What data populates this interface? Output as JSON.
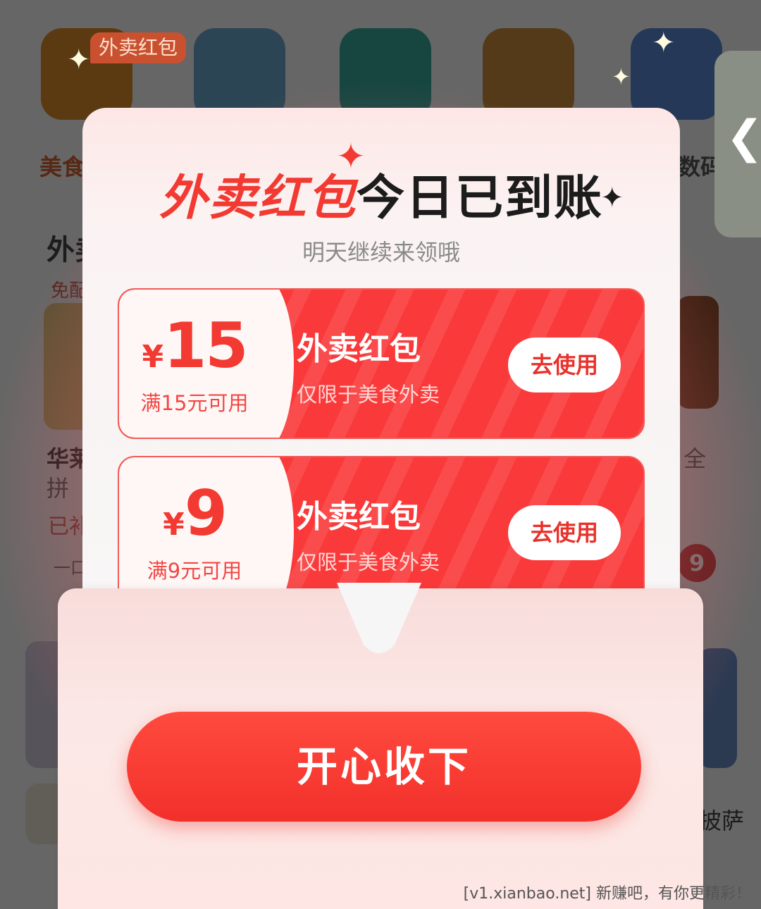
{
  "background": {
    "category_tag": "外卖红包",
    "categories": [
      "美食",
      "数码"
    ],
    "section_title": "外卖",
    "free_tag": "免配",
    "item_name_1": "华莱",
    "item_name_2": "拼",
    "sold_text": "已补",
    "item_name_right": "全",
    "one_tag": "一口",
    "badge_num": "9",
    "pizza_text": "披萨",
    "side_tab_glyph": "❮"
  },
  "modal": {
    "title_red": "外卖红包",
    "title_dark": "今日已到账",
    "subtitle": "明天继续来领哦",
    "coupons": [
      {
        "currency": "¥",
        "amount": "15",
        "condition": "满15元可用",
        "title": "外卖红包",
        "desc": "仅限于美食外卖",
        "button": "去使用"
      },
      {
        "currency": "¥",
        "amount": "9",
        "condition": "满9元可用",
        "title": "外卖红包",
        "desc": "仅限于美食外卖",
        "button": "去使用"
      }
    ],
    "cta": "开心收下"
  },
  "watermark": "[v1.xianbao.net] 新赚吧，有你更精彩！",
  "colors": {
    "accent_red": "#f23a32",
    "button_red": "#f2302b",
    "text_dark": "#1c1c1c"
  }
}
